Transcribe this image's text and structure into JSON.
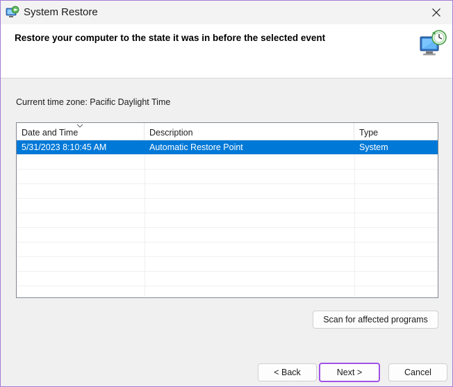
{
  "window": {
    "title": "System Restore",
    "icon": "system-restore-icon",
    "close_icon": "close-icon"
  },
  "header": {
    "title": "Restore your computer to the state it was in before the selected event",
    "icon": "restore-computer-icon"
  },
  "timezone_label": "Current time zone: Pacific Daylight Time",
  "restore_points": {
    "columns": [
      "Date and Time",
      "Description",
      "Type"
    ],
    "sort_indicator": "sort-descending-icon",
    "rows": [
      {
        "date": "5/31/2023 8:10:45 AM",
        "description": "Automatic Restore Point",
        "type": "System",
        "selected": true
      }
    ]
  },
  "buttons": {
    "scan": "Scan for affected programs",
    "back": "< Back",
    "next": "Next >",
    "cancel": "Cancel"
  },
  "colors": {
    "selection": "#0078d7",
    "focus_border": "#a052e6",
    "window_border": "#a47ad6"
  }
}
